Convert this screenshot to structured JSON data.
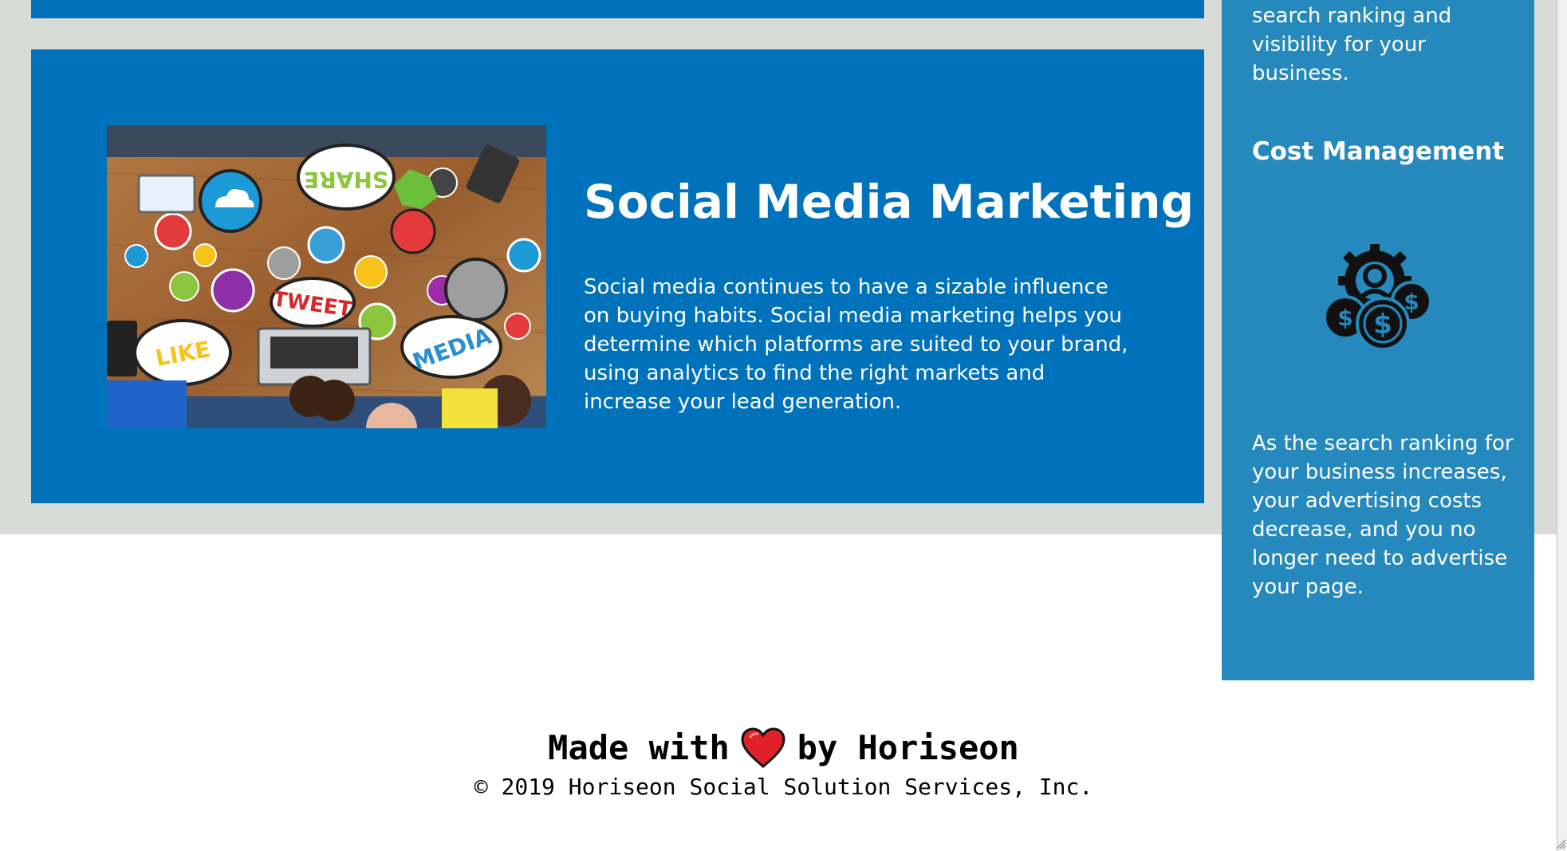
{
  "colors": {
    "card_blue": "#0072bb",
    "sidebar_blue": "#2589bd",
    "background_gray": "#d9dbd8",
    "heart_red": "#e0212a"
  },
  "service": {
    "title": "Social Media Marketing",
    "text": "Social media continues to have a sizable influence on buying habits. Social media marketing helps you determine which platforms are suited to your brand, using analytics to find the right markets and increase your lead generation.",
    "image_labels": {
      "share": "SHARE",
      "tweet": "TWEET",
      "like": "LIKE",
      "media": "MEDIA"
    }
  },
  "sidebar": {
    "previous_text": "search ranking and visibility for your business.",
    "heading": "Cost Management",
    "icon": "cost-management-icon",
    "text": "As the search ranking for your business increases, your advertising costs decrease, and you no longer need to advertise your page."
  },
  "footer": {
    "made_with": "Made with",
    "by": "by Horiseon",
    "copyright": "© 2019 Horiseon Social Solution Services, Inc."
  }
}
